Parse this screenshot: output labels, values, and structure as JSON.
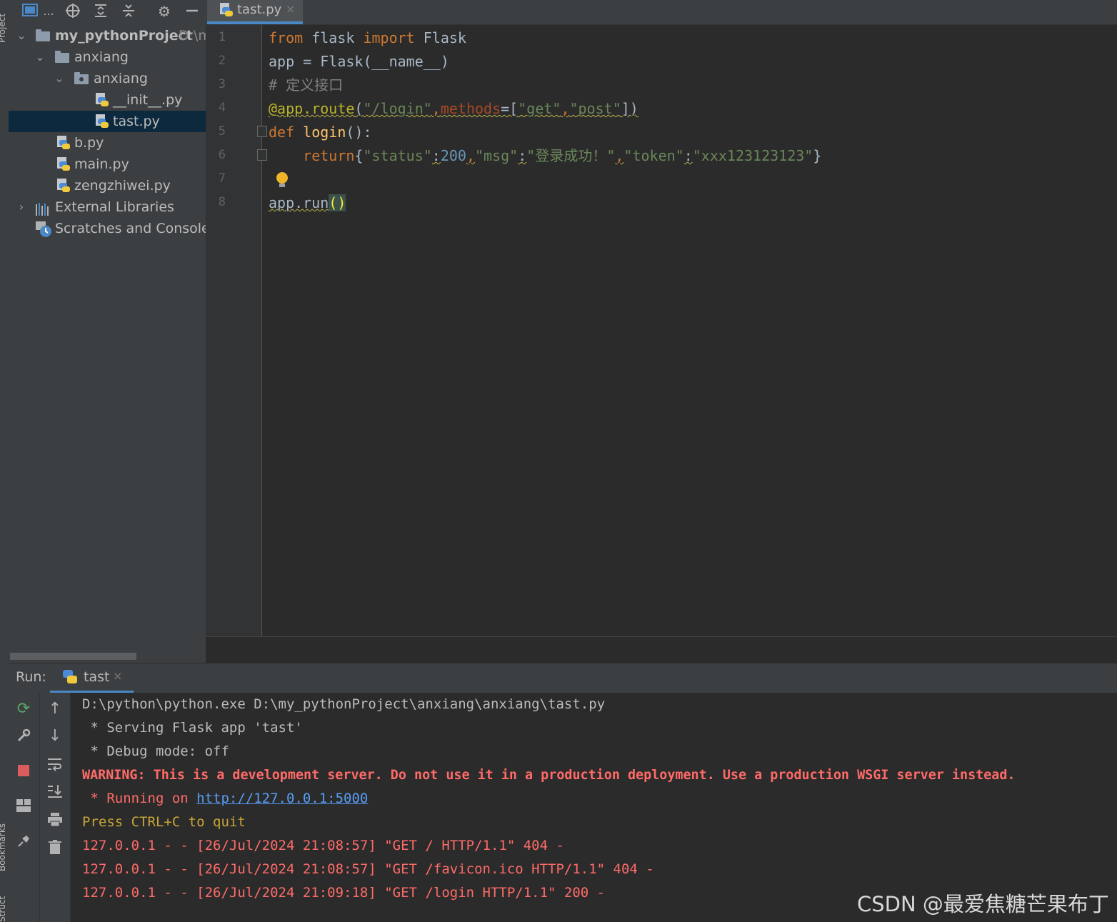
{
  "side_strip": {
    "top_label": "Project",
    "middle_label": "Bookmarks",
    "bottom_label": "Structure"
  },
  "project_toolbar": {
    "icons": [
      "project-view-icon",
      "locate-icon",
      "expand-all-icon",
      "collapse-all-icon",
      "gear-icon",
      "minimize-icon"
    ],
    "ellipsis": "..."
  },
  "project_tree": {
    "root_name": "my_pythonProject",
    "root_path": "D:\\m",
    "folder1": "anxiang",
    "folder2": "anxiang",
    "file_init": "__init__.py",
    "file_tast": "tast.py",
    "file_b": "b.py",
    "file_main": "main.py",
    "file_zeng": "zengzhiwei.py",
    "external_libraries": "External Libraries",
    "scratches": "Scratches and Consoles"
  },
  "editor_tab": {
    "label": "tast.py",
    "close": "×"
  },
  "editor": {
    "line_numbers": [
      "1",
      "2",
      "3",
      "4",
      "5",
      "6",
      "7",
      "8"
    ],
    "l1": {
      "from": "from",
      "mod": " flask ",
      "imp": "import",
      "cls": " Flask"
    },
    "l2": {
      "text": "app = Flask(__name__)"
    },
    "l3": {
      "comment": "# 定义接口"
    },
    "l4": {
      "deco": "@app.route",
      "p1": "(",
      "s1": "\"/login\"",
      "c1": ",",
      "param": "methods",
      "eq": "=[",
      "s2": "\"get\"",
      "c2": ",",
      "s3": "\"post\"",
      "end": "])"
    },
    "l5": {
      "def": "def",
      "sp": " ",
      "fn": "login",
      "rest": "():"
    },
    "l6": {
      "indent": "    ",
      "ret": "return",
      "b1": "{",
      "k1": "\"status\"",
      "col1": ":",
      "v1": "200",
      "c1": ",",
      "k2": "\"msg\"",
      "col2": ":",
      "v2": "\"登录成功！\"",
      "c2": ",",
      "k3": "\"token\"",
      "col3": ":",
      "v3": "\"xxx123123123\"",
      "b2": "}"
    },
    "l8": {
      "call": "app.run",
      "parens": "()"
    }
  },
  "run_panel": {
    "label": "Run:",
    "tab_label": "tast",
    "tab_close": "×",
    "toolbar_left_icons": [
      "rerun-icon",
      "wrench-icon",
      "stop-icon",
      "layout-icon",
      "pin-icon"
    ],
    "toolbar_right_icons": [
      "arrow-up-icon",
      "arrow-down-icon",
      "soft-wrap-icon",
      "scroll-to-end-icon",
      "print-icon",
      "trash-icon"
    ]
  },
  "console": {
    "l1": "D:\\python\\python.exe D:\\my_pythonProject\\anxiang\\anxiang\\tast.py",
    "l2": " * Serving Flask app 'tast'",
    "l3": " * Debug mode: off",
    "l4": "WARNING: This is a development server. Do not use it in a production deployment. Use a production WSGI server instead.",
    "l5_prefix": " * Running on ",
    "l5_link": "http://127.0.0.1:5000",
    "l6": "Press CTRL+C to quit",
    "l7": "127.0.0.1 - - [26/Jul/2024 21:08:57] \"GET / HTTP/1.1\" 404 -",
    "l8": "127.0.0.1 - - [26/Jul/2024 21:08:57] \"GET /favicon.ico HTTP/1.1\" 404 -",
    "l9": "127.0.0.1 - - [26/Jul/2024 21:09:18] \"GET /login HTTP/1.1\" 200 -"
  },
  "watermark": "CSDN @最爱焦糖芒果布丁",
  "colors": {
    "background": "#2b2b2b",
    "panel": "#3c3f41",
    "keyword": "#cc7832",
    "string": "#6a8759",
    "number": "#6897bb",
    "function": "#ffc66d",
    "error": "#ff6b68",
    "link": "#589df6",
    "selection": "#0d293e",
    "tab_underline": "#4a88c7"
  }
}
